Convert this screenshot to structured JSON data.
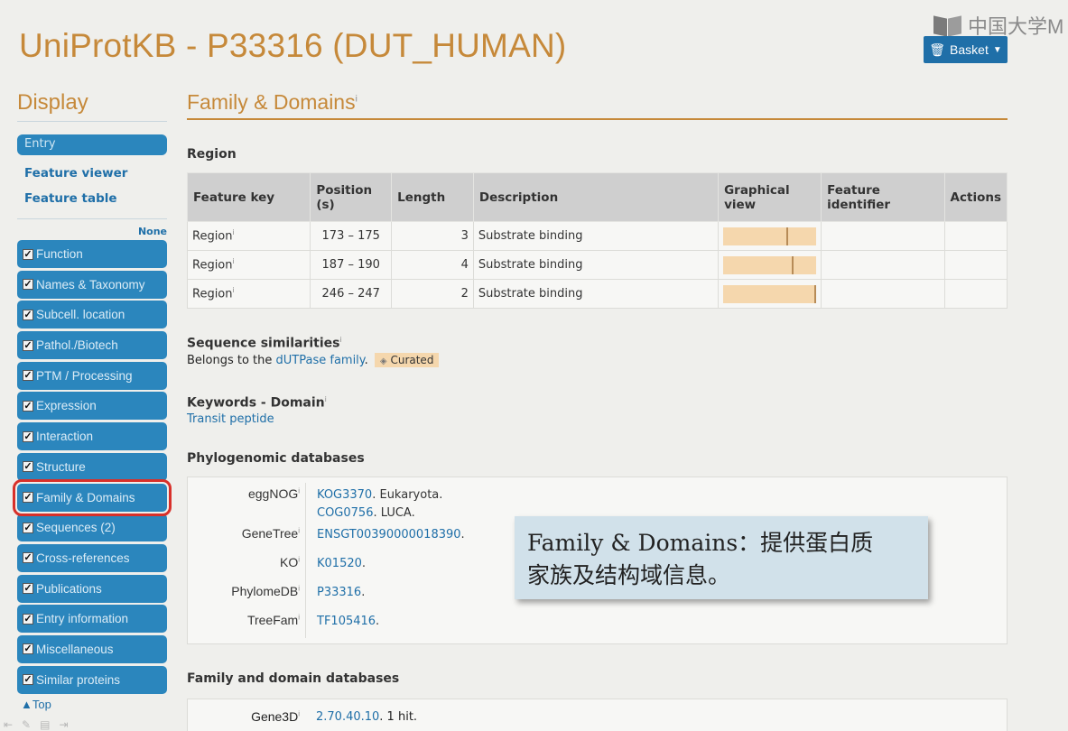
{
  "header": {
    "title": "UniProtKB - P33316 (DUT_HUMAN)",
    "watermark": "中国大学M",
    "basket_label": "Basket"
  },
  "sidebar": {
    "heading": "Display",
    "entry_label": "Entry",
    "links": [
      "Feature viewer",
      "Feature table"
    ],
    "none_label": "None",
    "sections": [
      "Function",
      "Names & Taxonomy",
      "Subcell. location",
      "Pathol./Biotech",
      "PTM / Processing",
      "Expression",
      "Interaction",
      "Structure",
      "Family & Domains",
      "Sequences (2)",
      "Cross-references",
      "Publications",
      "Entry information",
      "Miscellaneous",
      "Similar proteins"
    ],
    "active_section": "Family & Domains",
    "top_label": "Top"
  },
  "main": {
    "section_title": "Family & Domains",
    "region": {
      "heading": "Region",
      "columns": [
        "Feature key",
        "Position (s)",
        "Length",
        "Description",
        "Graphical view",
        "Feature identifier",
        "Actions"
      ],
      "rows": [
        {
          "key": "Region",
          "position": "173 – 175",
          "length": "3",
          "description": "Substrate binding",
          "mark_fraction": 0.68
        },
        {
          "key": "Region",
          "position": "187 – 190",
          "length": "4",
          "description": "Substrate binding",
          "mark_fraction": 0.74
        },
        {
          "key": "Region",
          "position": "246 – 247",
          "length": "2",
          "description": "Substrate binding",
          "mark_fraction": 0.98
        }
      ]
    },
    "similarities": {
      "heading": "Sequence similarities",
      "prefix": "Belongs to the ",
      "link": "dUTPase family",
      "suffix": ".",
      "badge": "Curated"
    },
    "keywords": {
      "heading": "Keywords - Domain",
      "value": "Transit peptide"
    },
    "phylogenomic": {
      "heading": "Phylogenomic databases",
      "rows": [
        {
          "label": "eggNOG",
          "lines": [
            {
              "link": "KOG3370",
              "text": ". Eukaryota."
            },
            {
              "link": "COG0756",
              "text": ". LUCA."
            }
          ]
        },
        {
          "label": "GeneTree",
          "lines": [
            {
              "link": "ENSGT00390000018390",
              "text": "."
            }
          ]
        },
        {
          "label": "KO",
          "lines": [
            {
              "link": "K01520",
              "text": "."
            }
          ]
        },
        {
          "label": "PhylomeDB",
          "lines": [
            {
              "link": "P33316",
              "text": "."
            }
          ]
        },
        {
          "label": "TreeFam",
          "lines": [
            {
              "link": "TF105416",
              "text": "."
            }
          ]
        }
      ]
    },
    "family_db": {
      "heading": "Family and domain databases",
      "gene3d_label": "Gene3D",
      "gene3d_link": "2.70.40.10",
      "gene3d_text": ". 1 hit."
    }
  },
  "overlay": {
    "line1": "Family & Domains：提供蛋白质",
    "line2": "家族及结构域信息。"
  }
}
